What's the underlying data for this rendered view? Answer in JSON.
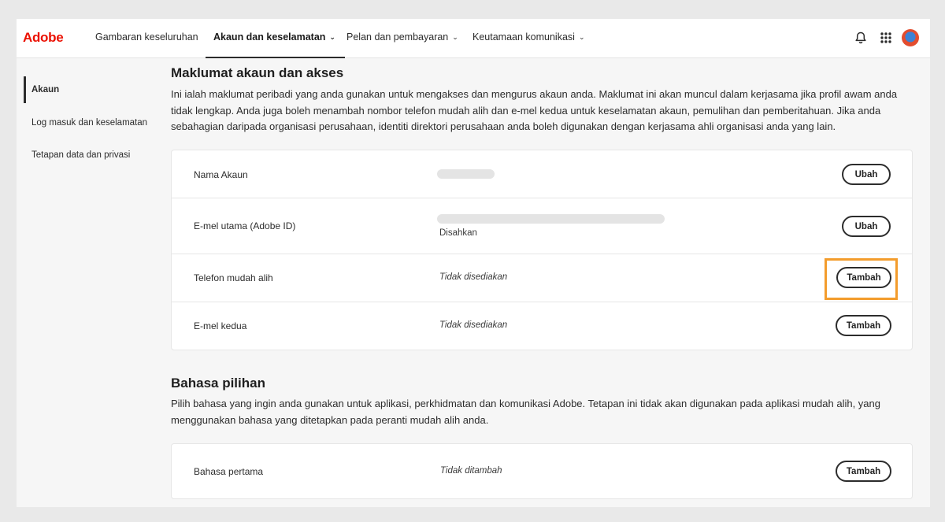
{
  "header": {
    "logo": "Adobe",
    "tabs": [
      {
        "label": "Gambaran keseluruhan"
      },
      {
        "label": "Akaun dan keselamatan"
      },
      {
        "label": "Pelan dan pembayaran"
      },
      {
        "label": "Keutamaan komunikasi"
      }
    ]
  },
  "sidebar": {
    "items": [
      {
        "label": "Akaun"
      },
      {
        "label": "Log masuk dan keselamatan"
      },
      {
        "label": "Tetapan data dan privasi"
      }
    ]
  },
  "account_section": {
    "title": "Maklumat akaun dan akses",
    "description": "Ini ialah maklumat peribadi yang anda gunakan untuk mengakses dan mengurus akaun anda. Maklumat ini akan muncul dalam kerjasama jika profil awam anda tidak lengkap. Anda juga boleh menambah nombor telefon mudah alih dan e-mel kedua untuk keselamatan akaun, pemulihan dan pemberitahuan. Jika anda sebahagian daripada organisasi perusahaan, identiti direktori perusahaan anda boleh digunakan dengan kerjasama ahli organisasi anda yang lain.",
    "rows": [
      {
        "label": "Nama Akaun",
        "value": "",
        "button": "Ubah"
      },
      {
        "label": "E-mel utama (Adobe ID)",
        "value": "",
        "sub": "Disahkan",
        "button": "Ubah"
      },
      {
        "label": "Telefon mudah alih",
        "value": "Tidak disediakan",
        "button": "Tambah"
      },
      {
        "label": "E-mel kedua",
        "value": "Tidak disediakan",
        "button": "Tambah"
      }
    ]
  },
  "language_section": {
    "title": "Bahasa pilihan",
    "description": "Pilih bahasa yang ingin anda gunakan untuk aplikasi, perkhidmatan dan komunikasi Adobe. Tetapan ini tidak akan digunakan pada aplikasi mudah alih, yang menggunakan bahasa yang ditetapkan pada peranti mudah alih anda.",
    "rows": [
      {
        "label": "Bahasa pertama",
        "value": "Tidak ditambah",
        "button": "Tambah"
      }
    ]
  },
  "colors": {
    "brand": "#eb1000",
    "highlight": "#f39c2c"
  }
}
